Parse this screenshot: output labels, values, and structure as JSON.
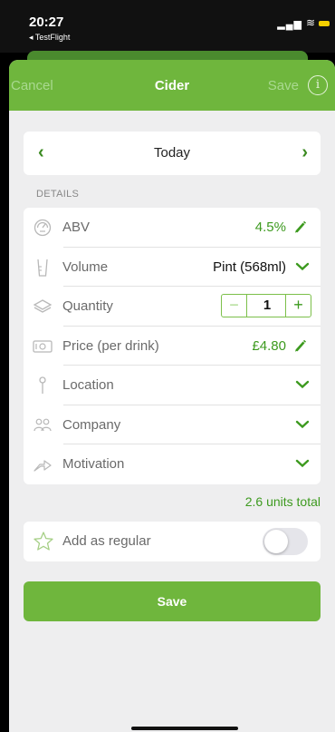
{
  "status_bar": {
    "time": "20:27",
    "back_app": "◂ TestFlight",
    "signal": "▂▄▆",
    "wifi": "≋"
  },
  "nav": {
    "cancel_label": "Cancel",
    "title": "Cider",
    "save_label": "Save",
    "info_symbol": "i"
  },
  "date": {
    "prev": "‹",
    "label": "Today",
    "next": "›"
  },
  "details": {
    "header": "DETAILS",
    "rows": [
      {
        "label": "ABV",
        "value": "4.5%",
        "icon": "gauge-icon",
        "control": "edit"
      },
      {
        "label": "Volume",
        "value": "Pint (568ml)",
        "icon": "glass-icon",
        "control": "dropdown"
      },
      {
        "label": "Quantity",
        "value": "1",
        "icon": "layers-icon",
        "control": "stepper"
      },
      {
        "label": "Price (per drink)",
        "value": "£4.80",
        "icon": "money-icon",
        "control": "edit"
      },
      {
        "label": "Location",
        "value": "",
        "icon": "pin-icon",
        "control": "dropdown"
      },
      {
        "label": "Company",
        "value": "",
        "icon": "people-icon",
        "control": "dropdown"
      },
      {
        "label": "Motivation",
        "value": "",
        "icon": "arrow-icon",
        "control": "dropdown"
      }
    ],
    "stepper_minus": "−",
    "stepper_plus": "+"
  },
  "units_total": "2.6 units total",
  "regular": {
    "label": "Add as regular",
    "enabled": false
  },
  "save_button_label": "Save",
  "colors": {
    "accent": "#6fb63d",
    "accent_text": "#3d9a1f",
    "background": "#eeeeef"
  }
}
